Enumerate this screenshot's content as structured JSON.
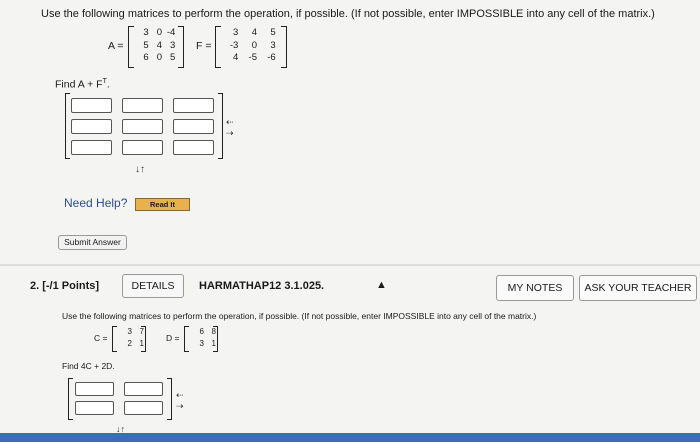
{
  "q1": {
    "instructions": "Use the following matrices to perform the operation, if possible. (If not possible, enter IMPOSSIBLE into any cell of the matrix.)",
    "matrix_a_label": "A =",
    "matrix_a": [
      [
        "3",
        "0",
        "-4"
      ],
      [
        "5",
        "4",
        "3"
      ],
      [
        "6",
        "0",
        "5"
      ]
    ],
    "matrix_f_label": "F =",
    "matrix_f": [
      [
        "3",
        "4",
        "5"
      ],
      [
        "-3",
        "0",
        "3"
      ],
      [
        "4",
        "-5",
        "-6"
      ]
    ],
    "find_label": "Find A + F",
    "find_superscript": "T",
    "find_suffix": ".",
    "answer_rows": 3,
    "answer_cols": 3,
    "need_help_label": "Need Help?",
    "read_it_label": "Read It",
    "submit_label": "Submit Answer"
  },
  "q2": {
    "number_label": "2. [-/1 Points]",
    "details_label": "DETAILS",
    "source_label": "HARMATHAP12 3.1.025.",
    "my_notes_label": "MY NOTES",
    "ask_teacher_label": "ASK YOUR TEACHER",
    "instructions": "Use the following matrices to perform the operation, if possible. (If not possible, enter IMPOSSIBLE into any cell of the matrix.)",
    "matrix_c_label": "C =",
    "matrix_c": [
      [
        "3",
        "7"
      ],
      [
        "2",
        "1"
      ]
    ],
    "matrix_d_label": "D =",
    "matrix_d": [
      [
        "6",
        "8"
      ],
      [
        "3",
        "1"
      ]
    ],
    "find_label": "Find 4C + 2D."
  },
  "colors": {
    "background": "#f4f4f2",
    "need_help": "#2a4f8a",
    "read_it_bg": "#e8b24a",
    "divider": "#dcdcdc"
  }
}
